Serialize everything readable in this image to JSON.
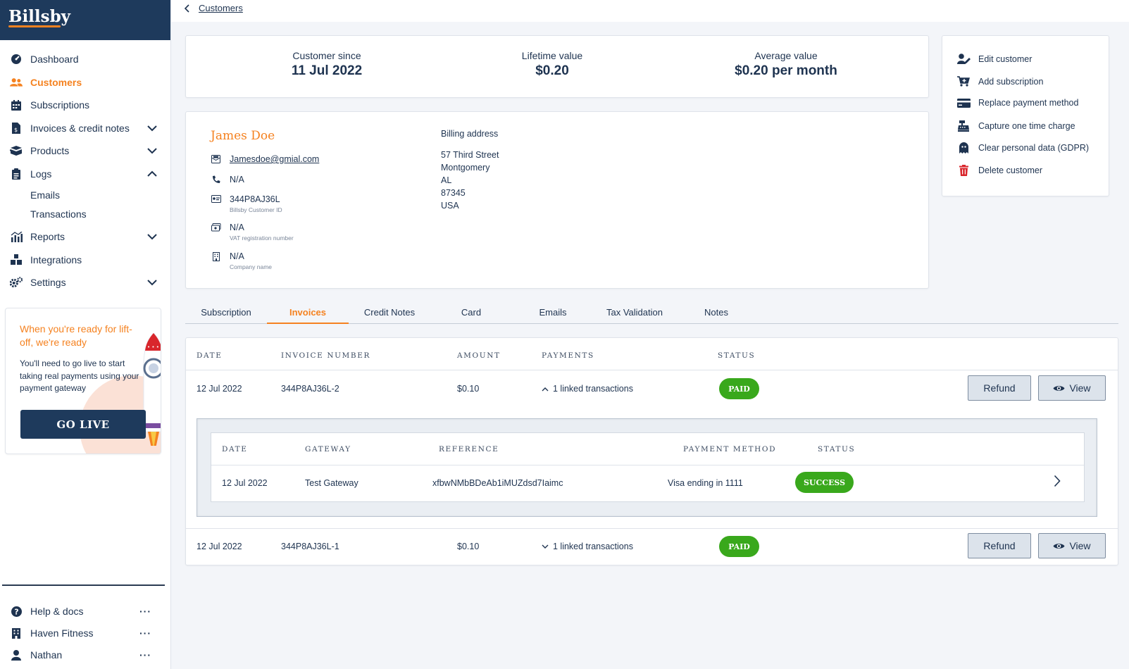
{
  "brand": {
    "name": "Billsby"
  },
  "sidebar": {
    "items": [
      {
        "label": "Dashboard",
        "icon": "dashboard-icon"
      },
      {
        "label": "Customers",
        "icon": "users-icon",
        "active": true
      },
      {
        "label": "Subscriptions",
        "icon": "calendar-icon"
      },
      {
        "label": "Invoices & credit notes",
        "icon": "invoice-icon",
        "expandable": true
      },
      {
        "label": "Products",
        "icon": "boxes-icon",
        "expandable": true
      },
      {
        "label": "Logs",
        "icon": "clipboard-icon",
        "expanded": true
      },
      {
        "label": "Reports",
        "icon": "chart-icon",
        "expandable": true
      },
      {
        "label": "Integrations",
        "icon": "integrations-icon"
      },
      {
        "label": "Settings",
        "icon": "gears-icon",
        "expandable": true
      }
    ],
    "logs_sub": [
      "Emails",
      "Transactions"
    ],
    "promo": {
      "title": "When you're ready for lift-off, we're ready",
      "body": "You'll need to go live to start taking real payments using your payment gateway",
      "button": "GO LIVE"
    },
    "footer": [
      {
        "label": "Help & docs",
        "icon": "help-icon",
        "more": "···"
      },
      {
        "label": "Haven Fitness",
        "icon": "building-icon",
        "more": "···"
      },
      {
        "label": "Nathan",
        "icon": "user-icon",
        "more": "···"
      }
    ]
  },
  "breadcrumb": {
    "label": "Customers"
  },
  "stats": {
    "customer_since": {
      "label": "Customer since",
      "value": "11 Jul 2022"
    },
    "lifetime_value": {
      "label": "Lifetime value",
      "value": "$0.20"
    },
    "average_value": {
      "label": "Average value",
      "value": "$0.20 per month"
    }
  },
  "customer": {
    "name": "James Doe",
    "email": "Jamesdoe@gmial.com",
    "phone": "N/A",
    "customer_id": "344P8AJ36L",
    "customer_id_label": "Billsby Customer ID",
    "vat": "N/A",
    "vat_label": "VAT registration number",
    "company": "N/A",
    "company_label": "Company name",
    "billing": {
      "heading": "Billing address",
      "lines": [
        "57 Third Street",
        "Montgomery",
        "AL",
        "87345",
        "USA"
      ]
    }
  },
  "actions": [
    {
      "label": "Edit customer",
      "icon": "user-edit-icon"
    },
    {
      "label": "Add subscription",
      "icon": "cart-plus-icon"
    },
    {
      "label": "Replace payment method",
      "icon": "credit-card-icon"
    },
    {
      "label": "Capture one time charge",
      "icon": "cash-register-icon"
    },
    {
      "label": "Clear personal data (GDPR)",
      "icon": "ghost-icon"
    },
    {
      "label": "Delete customer",
      "icon": "trash-icon"
    }
  ],
  "tabs": [
    "Subscription",
    "Invoices",
    "Credit Notes",
    "Card",
    "Emails",
    "Tax Validation",
    "Notes"
  ],
  "active_tab": "Invoices",
  "invoices": {
    "headers": [
      "DATE",
      "INVOICE NUMBER",
      "AMOUNT",
      "PAYMENTS",
      "STATUS"
    ],
    "rows": [
      {
        "date": "12 Jul 2022",
        "number": "344P8AJ36L-2",
        "amount": "$0.10",
        "payments": "1 linked transactions",
        "status": "PAID",
        "expanded": true,
        "refund": "Refund",
        "view": "View"
      },
      {
        "date": "12 Jul 2022",
        "number": "344P8AJ36L-1",
        "amount": "$0.10",
        "payments": "1 linked transactions",
        "status": "PAID",
        "expanded": false,
        "refund": "Refund",
        "view": "View"
      }
    ]
  },
  "transactions": {
    "headers": [
      "DATE",
      "GATEWAY",
      "REFERENCE",
      "PAYMENT METHOD",
      "STATUS"
    ],
    "rows": [
      {
        "date": "12 Jul 2022",
        "gateway": "Test Gateway",
        "reference": "xfbwNMbBDeAb1iMUZdsd7Iaimc",
        "method": "Visa ending in 1111",
        "status": "SUCCESS"
      }
    ]
  },
  "colors": {
    "navy": "#1e3a5c",
    "accent": "#f58220",
    "success": "#39a81c",
    "danger": "#d9262c"
  }
}
